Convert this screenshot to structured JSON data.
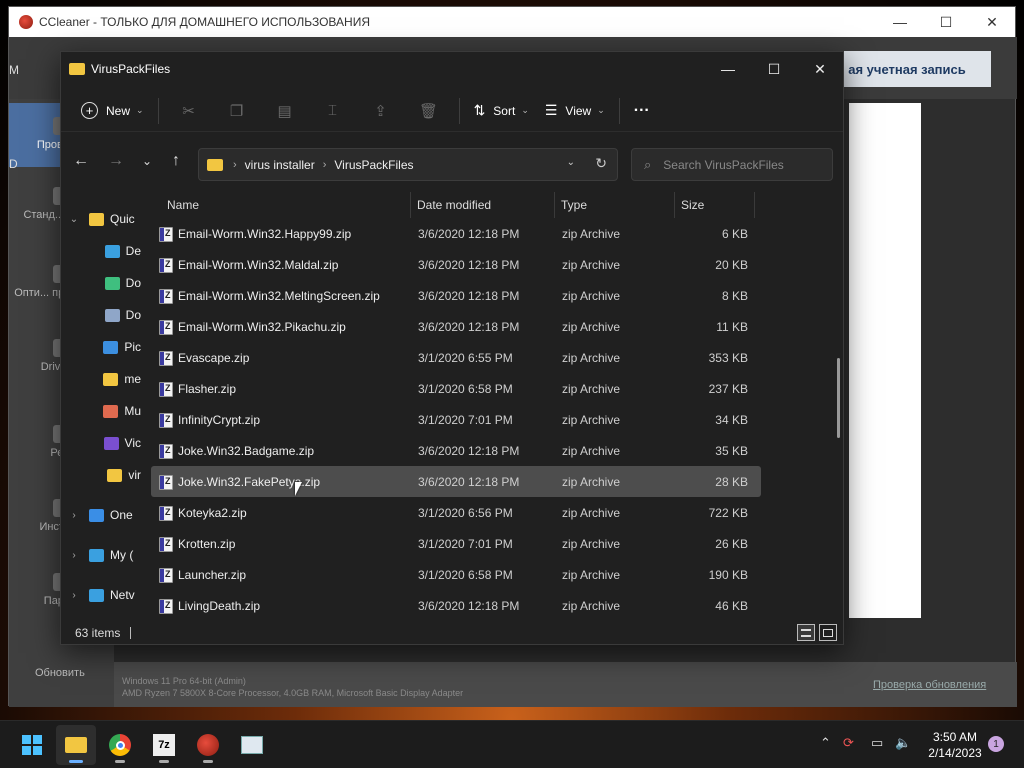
{
  "ccleaner": {
    "title": "CCleaner - ТОЛЬКО ДЛЯ ДОМАШНЕГО ИСПОЛЬЗОВАНИЯ",
    "account_label": "ая учетная запись",
    "nav": [
      "Проверка",
      "Станд... очис...",
      "Опти... производ...",
      "Driver ...",
      "Ре...",
      "Инстру...",
      "Пара..."
    ],
    "refresh_label": "Обновить",
    "sysinfo_line1": "Windows 11 Pro 64-bit (Admin)",
    "sysinfo_line2": "AMD Ryzen 7 5800X 8-Core Processor, 4.0GB RAM, Microsoft Basic Display Adapter",
    "update_link": "Проверка обновления",
    "left_glyph_m": "M",
    "left_glyph_d": "D"
  },
  "explorer": {
    "title": "VirusPackFiles",
    "commands": {
      "new": "New",
      "sort": "Sort",
      "view": "View",
      "more": "···"
    },
    "breadcrumb": [
      "virus installer",
      "VirusPackFiles"
    ],
    "search_placeholder": "Search VirusPackFiles",
    "nav_pane": [
      {
        "label": "Quic",
        "icon": "star-icon",
        "expand": "⌄",
        "color": "#f2c641"
      },
      {
        "label": "De",
        "icon": "desktop-icon",
        "expand": "",
        "color": "#3aa0e0"
      },
      {
        "label": "Do",
        "icon": "downloads-icon",
        "expand": "",
        "color": "#3fbf7f"
      },
      {
        "label": "Do",
        "icon": "documents-icon",
        "expand": "",
        "color": "#8fa6c8"
      },
      {
        "label": "Pic",
        "icon": "pictures-icon",
        "expand": "",
        "color": "#3c8fe0"
      },
      {
        "label": "me",
        "icon": "folder-icon",
        "expand": "",
        "color": "#f2c641"
      },
      {
        "label": "Mu",
        "icon": "music-icon",
        "expand": "",
        "color": "#e06a4f"
      },
      {
        "label": "Vic",
        "icon": "videos-icon",
        "expand": "",
        "color": "#7a4fd0"
      },
      {
        "label": "vir",
        "icon": "folder-icon",
        "expand": "",
        "color": "#f2c641"
      },
      {
        "label": "One",
        "icon": "onedrive-icon",
        "expand": "›",
        "color": "#3a8ee6"
      },
      {
        "label": "My (",
        "icon": "pc-icon",
        "expand": "›",
        "color": "#3aa0e0"
      },
      {
        "label": "Netv",
        "icon": "network-icon",
        "expand": "›",
        "color": "#3aa0e0"
      }
    ],
    "columns": {
      "name": "Name",
      "date": "Date modified",
      "type": "Type",
      "size": "Size"
    },
    "files": [
      {
        "name": "Email-Worm.Win32.Happy99.zip",
        "date": "3/6/2020 12:18 PM",
        "type": "zip Archive",
        "size": "6 KB"
      },
      {
        "name": "Email-Worm.Win32.Maldal.zip",
        "date": "3/6/2020 12:18 PM",
        "type": "zip Archive",
        "size": "20 KB"
      },
      {
        "name": "Email-Worm.Win32.MeltingScreen.zip",
        "date": "3/6/2020 12:18 PM",
        "type": "zip Archive",
        "size": "8 KB"
      },
      {
        "name": "Email-Worm.Win32.Pikachu.zip",
        "date": "3/6/2020 12:18 PM",
        "type": "zip Archive",
        "size": "11 KB"
      },
      {
        "name": "Evascape.zip",
        "date": "3/1/2020 6:55 PM",
        "type": "zip Archive",
        "size": "353 KB"
      },
      {
        "name": "Flasher.zip",
        "date": "3/1/2020 6:58 PM",
        "type": "zip Archive",
        "size": "237 KB"
      },
      {
        "name": "InfinityCrypt.zip",
        "date": "3/1/2020 7:01 PM",
        "type": "zip Archive",
        "size": "34 KB"
      },
      {
        "name": "Joke.Win32.Badgame.zip",
        "date": "3/6/2020 12:18 PM",
        "type": "zip Archive",
        "size": "35 KB"
      },
      {
        "name": "Joke.Win32.FakePetya.zip",
        "date": "3/6/2020 12:18 PM",
        "type": "zip Archive",
        "size": "28 KB",
        "selected": true
      },
      {
        "name": "Koteyka2.zip",
        "date": "3/1/2020 6:56 PM",
        "type": "zip Archive",
        "size": "722 KB"
      },
      {
        "name": "Krotten.zip",
        "date": "3/1/2020 7:01 PM",
        "type": "zip Archive",
        "size": "26 KB"
      },
      {
        "name": "Launcher.zip",
        "date": "3/1/2020 6:58 PM",
        "type": "zip Archive",
        "size": "190 KB"
      },
      {
        "name": "LivingDeath.zip",
        "date": "3/6/2020 12:18 PM",
        "type": "zip Archive",
        "size": "46 KB"
      }
    ],
    "status": "63 items"
  },
  "taskbar": {
    "apps": [
      "start-icon",
      "file-explorer-icon",
      "chrome-icon",
      "7zip-icon",
      "ccleaner-icon",
      "resource-monitor-icon"
    ],
    "time": "3:50 AM",
    "date": "2/14/2023",
    "notification_count": "1"
  }
}
